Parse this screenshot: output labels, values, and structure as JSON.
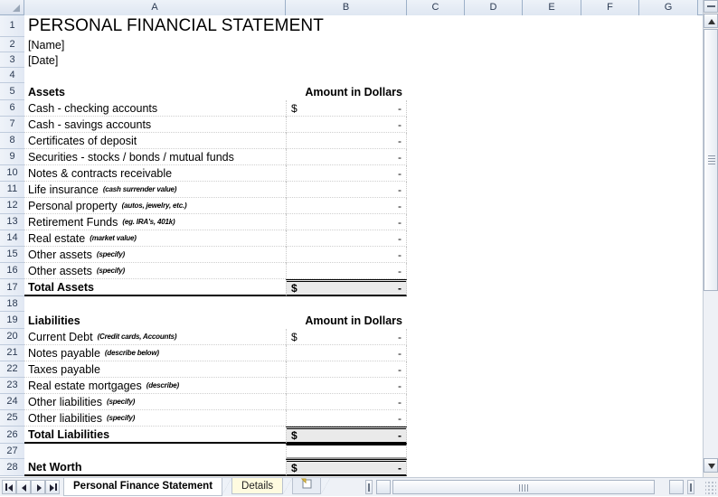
{
  "spreadsheet": {
    "column_headers": [
      "A",
      "B",
      "C",
      "D",
      "E",
      "F",
      "G"
    ],
    "rows": [
      {
        "n": "1",
        "a": "PERSONAL FINANCIAL STATEMENT",
        "style": "title"
      },
      {
        "n": "2",
        "a": "[Name]",
        "style": "plain"
      },
      {
        "n": "3",
        "a": "[Date]",
        "style": "plain"
      },
      {
        "n": "4",
        "a": "",
        "style": "plain"
      },
      {
        "n": "5",
        "a": "Assets",
        "b_label": "Amount in Dollars",
        "style": "section"
      },
      {
        "n": "6",
        "a": "Cash - checking accounts",
        "dollar": "$",
        "dash": "-",
        "style": "entry"
      },
      {
        "n": "7",
        "a": "Cash - savings accounts",
        "dollar": "",
        "dash": "-",
        "style": "entry"
      },
      {
        "n": "8",
        "a": "Certificates of deposit",
        "dollar": "",
        "dash": "-",
        "style": "entry"
      },
      {
        "n": "9",
        "a": "Securities - stocks / bonds / mutual funds",
        "dollar": "",
        "dash": "-",
        "style": "entry"
      },
      {
        "n": "10",
        "a": "Notes & contracts receivable",
        "dollar": "",
        "dash": "-",
        "style": "entry"
      },
      {
        "n": "11",
        "a": "Life insurance",
        "note": "(cash surrender value)",
        "dollar": "",
        "dash": "-",
        "style": "entry"
      },
      {
        "n": "12",
        "a": "Personal property",
        "note": "(autos, jewelry, etc.)",
        "dollar": "",
        "dash": "-",
        "style": "entry"
      },
      {
        "n": "13",
        "a": "Retirement Funds",
        "note": "(eg. IRA's, 401k)",
        "dollar": "",
        "dash": "-",
        "style": "entry"
      },
      {
        "n": "14",
        "a": "Real estate",
        "note": "(market value)",
        "dollar": "",
        "dash": "-",
        "style": "entry"
      },
      {
        "n": "15",
        "a": "Other assets",
        "note": "(specify)",
        "dollar": "",
        "dash": "-",
        "style": "entry"
      },
      {
        "n": "16",
        "a": "Other assets",
        "note": "(specify)",
        "dollar": "",
        "dash": "-",
        "style": "entry"
      },
      {
        "n": "17",
        "a": "Total Assets",
        "dollar": "$",
        "dash": "-",
        "style": "total"
      },
      {
        "n": "18",
        "a": "",
        "style": "plain"
      },
      {
        "n": "19",
        "a": "Liabilities",
        "b_label": "Amount in Dollars",
        "style": "section"
      },
      {
        "n": "20",
        "a": "Current Debt",
        "note": "(Credit cards, Accounts)",
        "dollar": "$",
        "dash": "-",
        "style": "entry"
      },
      {
        "n": "21",
        "a": "Notes payable",
        "note": "(describe below)",
        "dollar": "",
        "dash": "-",
        "style": "entry"
      },
      {
        "n": "22",
        "a": "Taxes payable",
        "dollar": "",
        "dash": "-",
        "style": "entry"
      },
      {
        "n": "23",
        "a": "Real estate mortgages",
        "note": "(describe)",
        "dollar": "",
        "dash": "-",
        "style": "entry"
      },
      {
        "n": "24",
        "a": "Other liabilities",
        "note": "(specify)",
        "dollar": "",
        "dash": "-",
        "style": "entry"
      },
      {
        "n": "25",
        "a": "Other liabilities",
        "note": "(specify)",
        "dollar": "",
        "dash": "-",
        "style": "entry"
      },
      {
        "n": "26",
        "a": "Total Liabilities",
        "dollar": "$",
        "dash": "-",
        "style": "total"
      },
      {
        "n": "27",
        "a": "",
        "style": "spacer-tot"
      },
      {
        "n": "28",
        "a": "Net Worth",
        "dollar": "$",
        "dash": "-",
        "style": "total"
      }
    ]
  },
  "sheet_tabs": {
    "active": "Personal Finance Statement",
    "items": [
      {
        "label": "Personal Finance Statement",
        "state": "active"
      },
      {
        "label": "Details",
        "state": "inactive"
      }
    ],
    "insert_sheet_label": "➕"
  },
  "navigation": {
    "first_label": "⏮",
    "prev_label": "◀",
    "next_label": "▶",
    "last_label": "⏭"
  },
  "colors": {
    "header_band": "#e4ebf4",
    "total_fill": "#eaeaea",
    "details_tab": "#fffbe0",
    "grid_line": "#cfcfcf"
  }
}
